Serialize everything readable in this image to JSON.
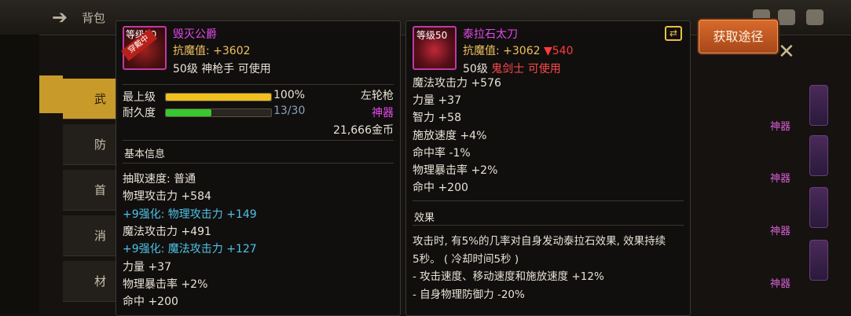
{
  "background": {
    "bag_title": "背包",
    "categories": [
      "武",
      "防",
      "首",
      "消",
      "材"
    ],
    "right_tags": [
      "神器",
      "神器",
      "神器",
      "神器",
      "神器"
    ],
    "acquire_button": "获取途径"
  },
  "left_item": {
    "level_badge": "等级50",
    "equipped_label": "穿戴中",
    "name": "毁灭公爵",
    "anti_magic_label": "抗魔值: ",
    "anti_magic_value": "+3602",
    "requirement": "50级 神枪手 可使用",
    "max_level_label": "最上级",
    "max_level_value": "100%",
    "max_level_fill": 1.0,
    "durability_label": "耐久度",
    "durability_value": "13/30",
    "durability_fill": 0.433,
    "weapon_type": "左轮枪",
    "rarity": "神器",
    "price": "21,666金币",
    "section_basic": "基本信息",
    "stats": [
      {
        "text": "抽取速度: 普通",
        "style": "normal"
      },
      {
        "text": "物理攻击力 +584",
        "style": "normal"
      },
      {
        "text": "+9强化: 物理攻击力 +149",
        "style": "cyan"
      },
      {
        "text": "魔法攻击力 +491",
        "style": "normal"
      },
      {
        "text": "+9强化: 魔法攻击力 +127",
        "style": "cyan"
      },
      {
        "text": "力量 +37",
        "style": "normal"
      },
      {
        "text": "物理暴击率 +2%",
        "style": "normal"
      },
      {
        "text": "命中 +200",
        "style": "normal"
      }
    ]
  },
  "right_item": {
    "level_badge": "等级50",
    "name": "泰拉石太刀",
    "anti_magic_label": "抗魔值: ",
    "anti_magic_value": "+3062",
    "anti_magic_diff": "▼540",
    "requirement_prefix": "50级 ",
    "requirement_class": "鬼剑士 可使用",
    "stats": [
      "魔法攻击力 +576",
      "力量 +37",
      "智力 +58",
      "施放速度 +4%",
      "命中率 -1%",
      "物理暴击率 +2%",
      "命中 +200"
    ],
    "section_effect": "效果",
    "effect_lines": [
      "攻击时, 有5%的几率对自身发动泰拉石效果, 效果持续",
      "5秒。 ( 冷却时间5秒 )",
      " - 攻击速度、移动速度和施放速度 +12%",
      " - 自身物理防御力 -20%"
    ]
  },
  "colors": {
    "item_name": "#e24be8",
    "anti_magic": "#f0c060",
    "decrease": "#ff3b3b",
    "enhance": "#4fc3e8",
    "level_bar": "#f0c020",
    "durability_bar": "#38c830"
  }
}
